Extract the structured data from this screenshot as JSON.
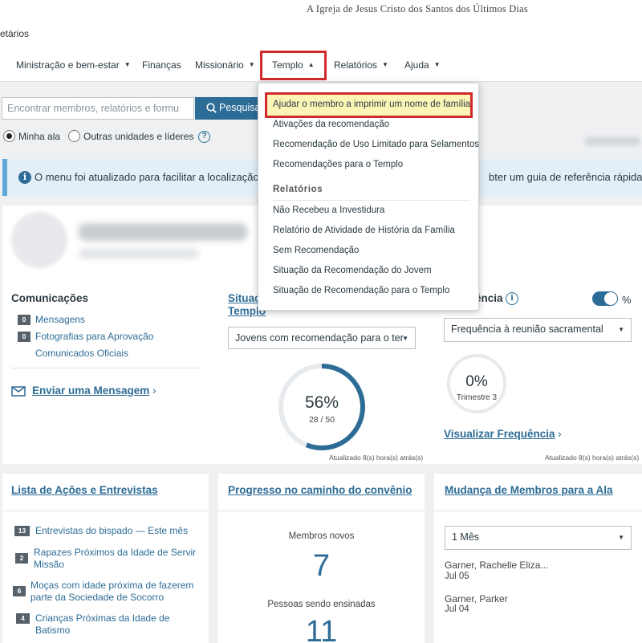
{
  "header": {
    "church_name": "A Igreja de Jesus Cristo dos Santos dos Últimos Dias",
    "breadcrumb": "etários"
  },
  "nav": {
    "items": [
      {
        "label": "Ministração e bem-estar",
        "has_caret": true
      },
      {
        "label": "Finanças",
        "has_caret": false
      },
      {
        "label": "Missionário",
        "has_caret": true
      },
      {
        "label": "Templo",
        "has_caret": true,
        "open": true
      },
      {
        "label": "Relatórios",
        "has_caret": true
      },
      {
        "label": "Ajuda",
        "has_caret": true
      }
    ]
  },
  "search": {
    "placeholder": "Encontrar membros, relatórios e formu",
    "button_label": "Pesquisar"
  },
  "scope": {
    "options": [
      "Minha ala",
      "Outras unidades e líderes"
    ],
    "selected": "Minha ala"
  },
  "notice": {
    "text_left": "O menu foi atualizado para facilitar a localização do",
    "text_right": "bter um guia de referência rápida."
  },
  "temple_menu": {
    "items": [
      "Ajudar o membro a imprimir um nome de família",
      "Ativações da recomendação",
      "Recomendação de Uso Limitado para Selamentos",
      "Recomendações para o Templo"
    ],
    "reports_heading": "Relatórios",
    "reports": [
      "Não Recebeu a Investidura",
      "Relatório de Atividade de História da Família",
      "Sem Recomendação",
      "Situação da Recomendação do Jovem",
      "Situação de Recomendação para o Templo"
    ]
  },
  "communications": {
    "title": "Comunicações",
    "items": [
      {
        "count": "0",
        "label": "Mensagens"
      },
      {
        "count": "0",
        "label": "Fotografias para Aprovação"
      },
      {
        "count": "",
        "label": "Comunicados Oficiais"
      }
    ],
    "send_message": "Enviar uma Mensagem"
  },
  "temple_status": {
    "title_line1": "Situaç",
    "title_line2": "Templo",
    "select_value": "Jovens com recomendação para o ter",
    "percent": "56%",
    "fraction": "28 / 50",
    "progress": 0.56,
    "updated": "Atualizado 8(s) hora(s) atrás(s)"
  },
  "attendance": {
    "title": "ência",
    "toggle_label": "%",
    "select_value": "Frequência à reunião sacramental",
    "percent": "0%",
    "period": "Trimestre 3",
    "link": "Visualizar Frequência",
    "updated": "Atualizado 8(s) hora(s) atrás(s)"
  },
  "actions": {
    "title": "Lista de Ações e Entrevistas",
    "items": [
      {
        "count": "13",
        "label": "Entrevistas do bispado — Este mês"
      },
      {
        "count": "2",
        "label": "Rapazes Próximos da Idade de Servir Missão"
      },
      {
        "count": "6",
        "label": "Moças com idade próxima de fazerem parte da Sociedade de Socorro"
      },
      {
        "count": "4",
        "label": "Crianças Próximas da Idade de Batismo"
      }
    ]
  },
  "covenant": {
    "title": "Progresso no caminho do convênio",
    "new_members_label": "Membros novos",
    "new_members_value": "7",
    "taught_label": "Pessoas sendo ensinadas",
    "taught_value": "11"
  },
  "moves": {
    "title": "Mudança de Membros para a Ala",
    "select_value": "1 Mês",
    "members": [
      {
        "name": "Garner, Rachelle Eliza...",
        "date": "Jul 05"
      },
      {
        "name": "Garner, Parker",
        "date": "Jul 04"
      }
    ]
  },
  "colors": {
    "accent": "#2d6c96",
    "highlight_border": "#d22a2a",
    "highlight_fill": "#fdf5b6",
    "ring_track": "#e7eaed"
  }
}
